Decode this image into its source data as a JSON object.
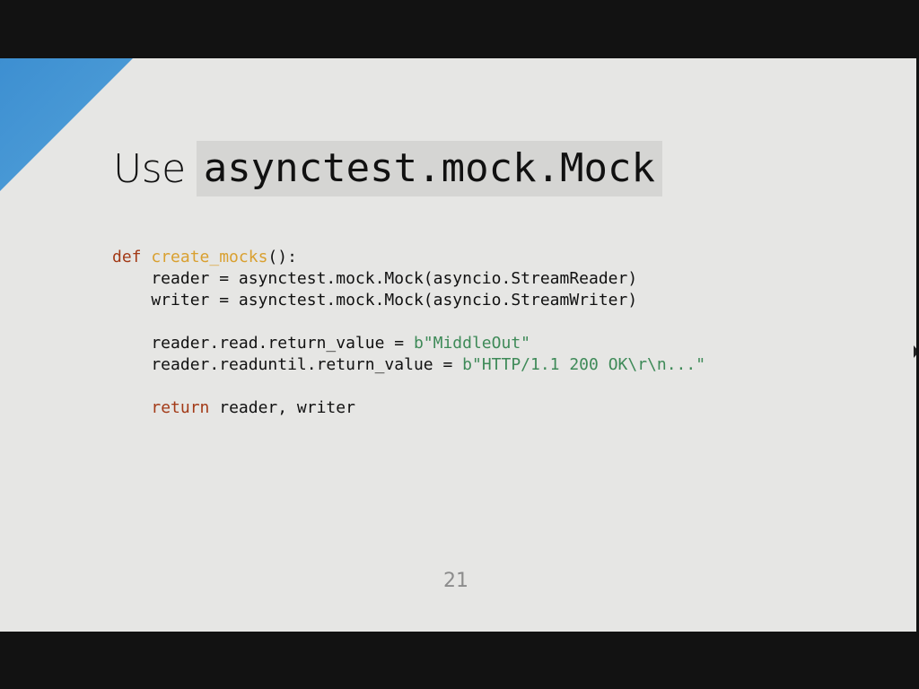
{
  "slide": {
    "title_prefix": "Use",
    "title_code": "asynctest.mock.Mock",
    "page_number": "21",
    "progress": 0.665,
    "colors": {
      "background": "#e6e6e4",
      "accent": "#4a9ad6",
      "keyword": "#a33a17",
      "function_name": "#d9a030",
      "string": "#3e8a58"
    }
  },
  "code": {
    "lines": [
      [
        {
          "t": "kw",
          "v": "def"
        },
        {
          "t": "plain",
          "v": " "
        },
        {
          "t": "fn",
          "v": "create_mocks"
        },
        {
          "t": "plain",
          "v": "():"
        }
      ],
      [
        {
          "t": "plain",
          "v": "    reader = asynctest.mock.Mock(asyncio.StreamReader)"
        }
      ],
      [
        {
          "t": "plain",
          "v": "    writer = asynctest.mock.Mock(asyncio.StreamWriter)"
        }
      ],
      [],
      [
        {
          "t": "plain",
          "v": "    reader.read.return_value = "
        },
        {
          "t": "str",
          "v": "b\"MiddleOut\""
        }
      ],
      [
        {
          "t": "plain",
          "v": "    reader.readuntil.return_value = "
        },
        {
          "t": "str",
          "v": "b\"HTTP/1.1 200 OK\\r\\n...\""
        }
      ],
      [],
      [
        {
          "t": "plain",
          "v": "    "
        },
        {
          "t": "kw",
          "v": "return"
        },
        {
          "t": "plain",
          "v": " reader, writer"
        }
      ]
    ]
  }
}
